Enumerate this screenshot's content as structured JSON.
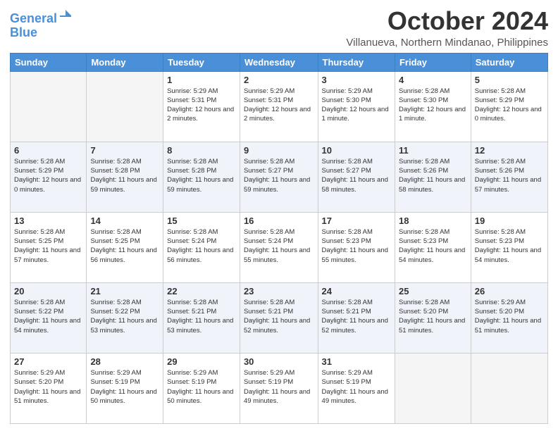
{
  "logo": {
    "line1": "General",
    "line2": "Blue"
  },
  "header": {
    "month": "October 2024",
    "location": "Villanueva, Northern Mindanao, Philippines"
  },
  "weekdays": [
    "Sunday",
    "Monday",
    "Tuesday",
    "Wednesday",
    "Thursday",
    "Friday",
    "Saturday"
  ],
  "weeks": [
    [
      {
        "day": "",
        "empty": true
      },
      {
        "day": "",
        "empty": true
      },
      {
        "day": "1",
        "sunrise": "5:29 AM",
        "sunset": "5:31 PM",
        "daylight": "12 hours and 2 minutes."
      },
      {
        "day": "2",
        "sunrise": "5:29 AM",
        "sunset": "5:31 PM",
        "daylight": "12 hours and 2 minutes."
      },
      {
        "day": "3",
        "sunrise": "5:29 AM",
        "sunset": "5:30 PM",
        "daylight": "12 hours and 1 minute."
      },
      {
        "day": "4",
        "sunrise": "5:28 AM",
        "sunset": "5:30 PM",
        "daylight": "12 hours and 1 minute."
      },
      {
        "day": "5",
        "sunrise": "5:28 AM",
        "sunset": "5:29 PM",
        "daylight": "12 hours and 0 minutes."
      }
    ],
    [
      {
        "day": "6",
        "sunrise": "5:28 AM",
        "sunset": "5:29 PM",
        "daylight": "12 hours and 0 minutes."
      },
      {
        "day": "7",
        "sunrise": "5:28 AM",
        "sunset": "5:28 PM",
        "daylight": "11 hours and 59 minutes."
      },
      {
        "day": "8",
        "sunrise": "5:28 AM",
        "sunset": "5:28 PM",
        "daylight": "11 hours and 59 minutes."
      },
      {
        "day": "9",
        "sunrise": "5:28 AM",
        "sunset": "5:27 PM",
        "daylight": "11 hours and 59 minutes."
      },
      {
        "day": "10",
        "sunrise": "5:28 AM",
        "sunset": "5:27 PM",
        "daylight": "11 hours and 58 minutes."
      },
      {
        "day": "11",
        "sunrise": "5:28 AM",
        "sunset": "5:26 PM",
        "daylight": "11 hours and 58 minutes."
      },
      {
        "day": "12",
        "sunrise": "5:28 AM",
        "sunset": "5:26 PM",
        "daylight": "11 hours and 57 minutes."
      }
    ],
    [
      {
        "day": "13",
        "sunrise": "5:28 AM",
        "sunset": "5:25 PM",
        "daylight": "11 hours and 57 minutes."
      },
      {
        "day": "14",
        "sunrise": "5:28 AM",
        "sunset": "5:25 PM",
        "daylight": "11 hours and 56 minutes."
      },
      {
        "day": "15",
        "sunrise": "5:28 AM",
        "sunset": "5:24 PM",
        "daylight": "11 hours and 56 minutes."
      },
      {
        "day": "16",
        "sunrise": "5:28 AM",
        "sunset": "5:24 PM",
        "daylight": "11 hours and 55 minutes."
      },
      {
        "day": "17",
        "sunrise": "5:28 AM",
        "sunset": "5:23 PM",
        "daylight": "11 hours and 55 minutes."
      },
      {
        "day": "18",
        "sunrise": "5:28 AM",
        "sunset": "5:23 PM",
        "daylight": "11 hours and 54 minutes."
      },
      {
        "day": "19",
        "sunrise": "5:28 AM",
        "sunset": "5:23 PM",
        "daylight": "11 hours and 54 minutes."
      }
    ],
    [
      {
        "day": "20",
        "sunrise": "5:28 AM",
        "sunset": "5:22 PM",
        "daylight": "11 hours and 54 minutes."
      },
      {
        "day": "21",
        "sunrise": "5:28 AM",
        "sunset": "5:22 PM",
        "daylight": "11 hours and 53 minutes."
      },
      {
        "day": "22",
        "sunrise": "5:28 AM",
        "sunset": "5:21 PM",
        "daylight": "11 hours and 53 minutes."
      },
      {
        "day": "23",
        "sunrise": "5:28 AM",
        "sunset": "5:21 PM",
        "daylight": "11 hours and 52 minutes."
      },
      {
        "day": "24",
        "sunrise": "5:28 AM",
        "sunset": "5:21 PM",
        "daylight": "11 hours and 52 minutes."
      },
      {
        "day": "25",
        "sunrise": "5:28 AM",
        "sunset": "5:20 PM",
        "daylight": "11 hours and 51 minutes."
      },
      {
        "day": "26",
        "sunrise": "5:29 AM",
        "sunset": "5:20 PM",
        "daylight": "11 hours and 51 minutes."
      }
    ],
    [
      {
        "day": "27",
        "sunrise": "5:29 AM",
        "sunset": "5:20 PM",
        "daylight": "11 hours and 51 minutes."
      },
      {
        "day": "28",
        "sunrise": "5:29 AM",
        "sunset": "5:19 PM",
        "daylight": "11 hours and 50 minutes."
      },
      {
        "day": "29",
        "sunrise": "5:29 AM",
        "sunset": "5:19 PM",
        "daylight": "11 hours and 50 minutes."
      },
      {
        "day": "30",
        "sunrise": "5:29 AM",
        "sunset": "5:19 PM",
        "daylight": "11 hours and 49 minutes."
      },
      {
        "day": "31",
        "sunrise": "5:29 AM",
        "sunset": "5:19 PM",
        "daylight": "11 hours and 49 minutes."
      },
      {
        "day": "",
        "empty": true
      },
      {
        "day": "",
        "empty": true
      }
    ]
  ]
}
